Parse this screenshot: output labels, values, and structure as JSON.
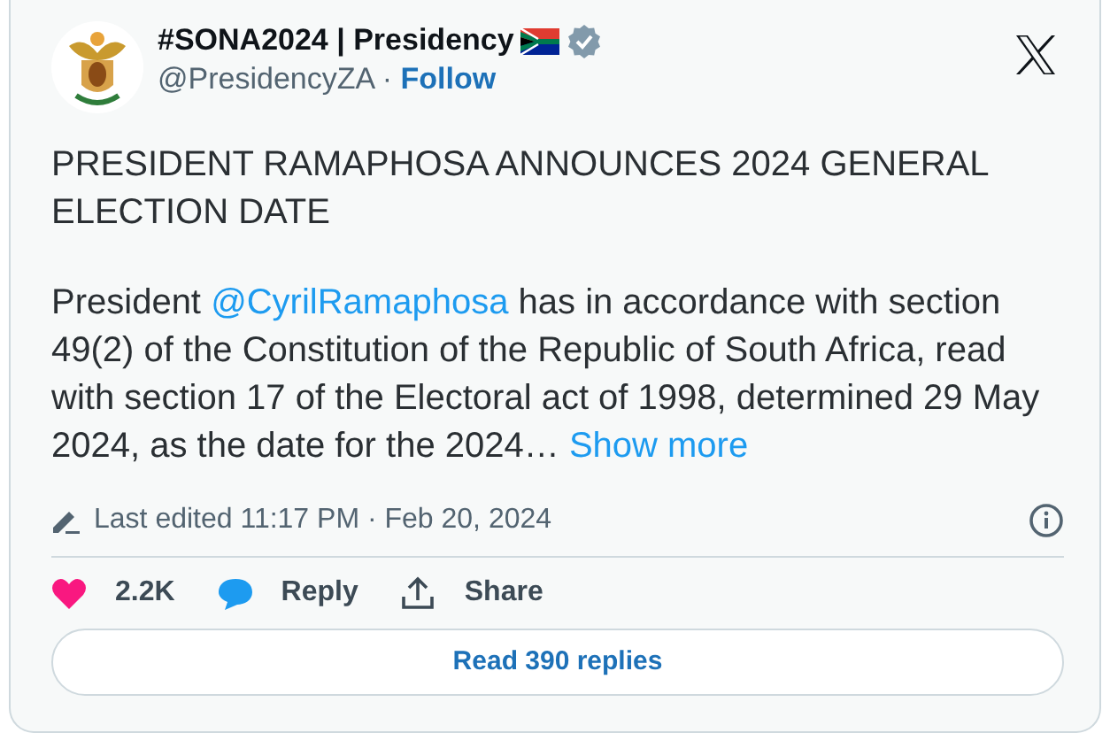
{
  "account": {
    "name": "#SONA2024 | Presidency",
    "handle": "@PresidencyZA",
    "separator": "·",
    "follow": "Follow",
    "verified": true
  },
  "headline": "PRESIDENT RAMAPHOSA ANNOUNCES 2024 GENERAL ELECTION DATE",
  "body": [
    {
      "kind": "text",
      "text": "President "
    },
    {
      "kind": "mention",
      "text": "@CyrilRamaphosa"
    },
    {
      "kind": "text",
      "text": " has in accordance with section 49(2) of the Constitution of the Republic of South Africa, read with section 17 of the Electoral act of 1998, determined 29 May 2024, as the date for the 2024…"
    }
  ],
  "show_more": "Show more",
  "edited": "Last edited 11:17 PM · Feb 20, 2024",
  "actions": [
    {
      "kind": "like",
      "label": "2.2K"
    },
    {
      "kind": "reply",
      "label": "Reply"
    },
    {
      "kind": "share",
      "label": "Share"
    }
  ],
  "read_replies": "Read 390 replies"
}
